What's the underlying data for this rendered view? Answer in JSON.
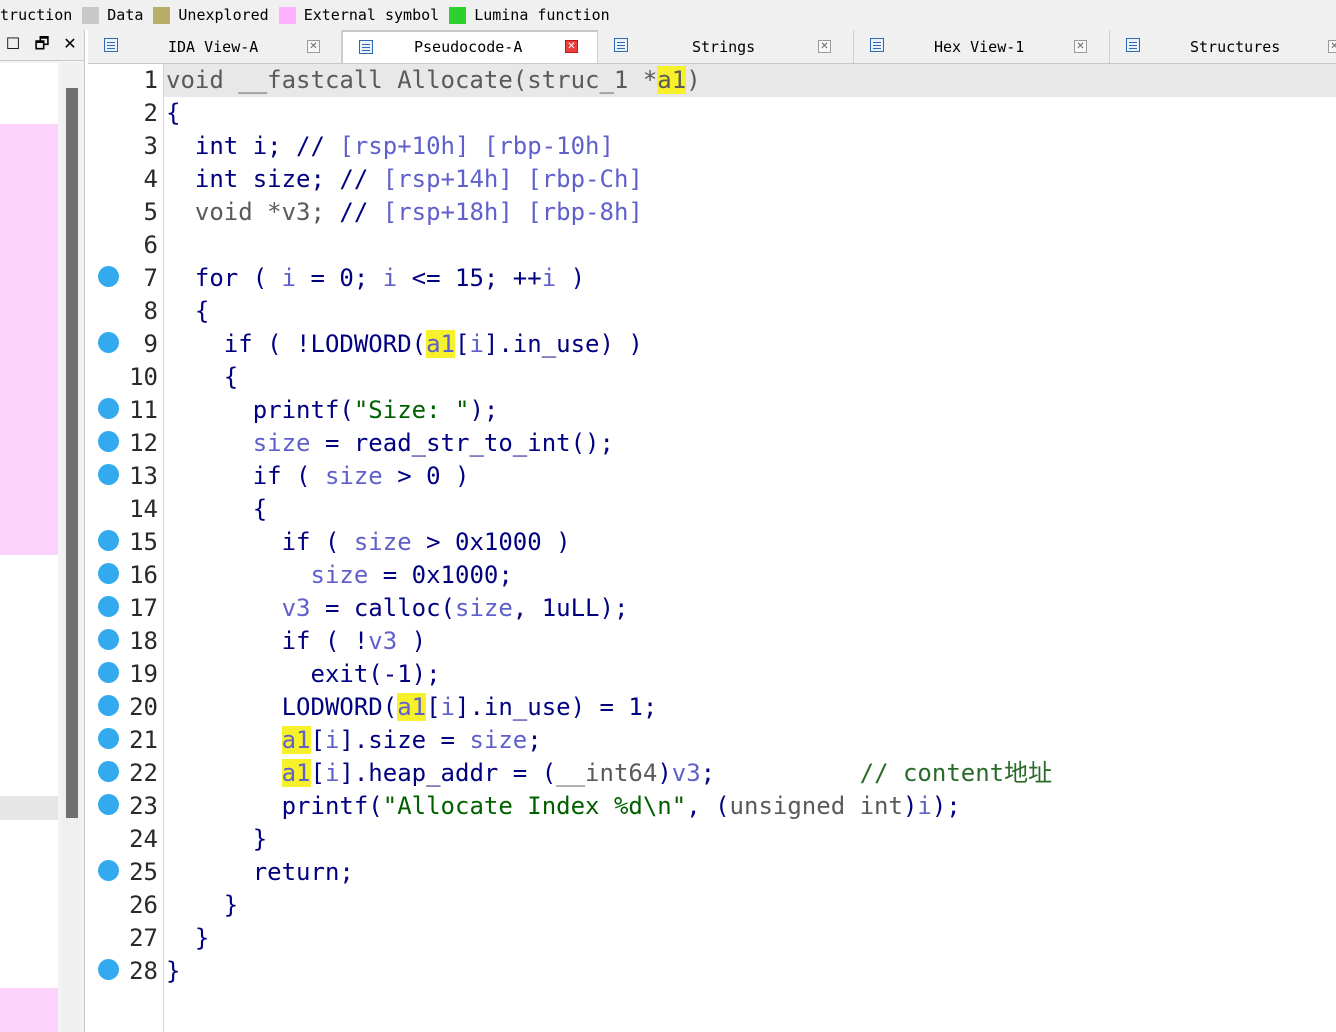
{
  "legend": {
    "first_label": "struction",
    "items": [
      {
        "label": "Data",
        "color": "#c8c8c8"
      },
      {
        "label": "Unexplored",
        "color": "#b8ae6a"
      },
      {
        "label": "External symbol",
        "color": "#ffb0ff"
      },
      {
        "label": "Lumina function",
        "color": "#2ed02e"
      }
    ]
  },
  "left_panel": {
    "buttons": [
      "☐",
      "🗗",
      "✕"
    ]
  },
  "tabs": [
    {
      "label": "IDA View-A",
      "icon": "ida-view-icon",
      "active": false
    },
    {
      "label": "Pseudocode-A",
      "icon": "pseudocode-icon",
      "active": true
    },
    {
      "label": "Strings",
      "icon": "strings-icon",
      "active": false
    },
    {
      "label": "Hex View-1",
      "icon": "hex-view-icon",
      "active": false
    },
    {
      "label": "Structures",
      "icon": "structures-icon",
      "active": false
    }
  ],
  "code": {
    "highlight_token": "a1",
    "lines": [
      {
        "n": "1",
        "bp": false,
        "html": "<span class=\"ty\">void __fastcall Allocate(struc_1 *</span><span class=\"ty hl\">a1</span><span class=\"ty\">)</span>"
      },
      {
        "n": "2",
        "bp": false,
        "html": "{"
      },
      {
        "n": "3",
        "bp": false,
        "html": "  int i; // <span class=\"cmv\">[rsp+10h] [rbp-10h]</span>"
      },
      {
        "n": "4",
        "bp": false,
        "html": "  int size; // <span class=\"cmv\">[rsp+14h] [rbp-Ch]</span>"
      },
      {
        "n": "5",
        "bp": false,
        "html": "  <span class=\"ty\">void *v3;</span> // <span class=\"cmv\">[rsp+18h] [rbp-8h]</span>"
      },
      {
        "n": "6",
        "bp": false,
        "html": ""
      },
      {
        "n": "7",
        "bp": true,
        "html": "  for ( <span class=\"va\">i</span> = 0; <span class=\"va\">i</span> &lt;= 15; ++<span class=\"va\">i</span> )"
      },
      {
        "n": "8",
        "bp": false,
        "html": "  {"
      },
      {
        "n": "9",
        "bp": true,
        "html": "    if ( !LODWORD(<span class=\"va hl\">a1</span>[<span class=\"va\">i</span>].in_use) )"
      },
      {
        "n": "10",
        "bp": false,
        "html": "    {"
      },
      {
        "n": "11",
        "bp": true,
        "html": "      printf(<span class=\"st\">\"Size: \"</span>);"
      },
      {
        "n": "12",
        "bp": true,
        "html": "      <span class=\"va\">size</span> = read_str_to_int();"
      },
      {
        "n": "13",
        "bp": true,
        "html": "      if ( <span class=\"va\">size</span> &gt; 0 )"
      },
      {
        "n": "14",
        "bp": false,
        "html": "      {"
      },
      {
        "n": "15",
        "bp": true,
        "html": "        if ( <span class=\"va\">size</span> &gt; 0x1000 )"
      },
      {
        "n": "16",
        "bp": true,
        "html": "          <span class=\"va\">size</span> = 0x1000;"
      },
      {
        "n": "17",
        "bp": true,
        "html": "        <span class=\"va\">v3</span> = calloc(<span class=\"va\">size</span>, 1uLL);"
      },
      {
        "n": "18",
        "bp": true,
        "html": "        if ( !<span class=\"va\">v3</span> )"
      },
      {
        "n": "19",
        "bp": true,
        "html": "          exit(-1);"
      },
      {
        "n": "20",
        "bp": true,
        "html": "        LODWORD(<span class=\"va hl\">a1</span>[<span class=\"va\">i</span>].in_use) = 1;"
      },
      {
        "n": "21",
        "bp": true,
        "html": "        <span class=\"va hl\">a1</span>[<span class=\"va\">i</span>].size = <span class=\"va\">size</span>;"
      },
      {
        "n": "22",
        "bp": true,
        "html": "        <span class=\"va hl\">a1</span>[<span class=\"va\">i</span>].heap_addr = (<span class=\"ty\">__int64</span>)<span class=\"va\">v3</span>;          <span class=\"cm\">// content地址</span>"
      },
      {
        "n": "23",
        "bp": true,
        "html": "        printf(<span class=\"st\">\"Allocate Index %d\\n\"</span>, (<span class=\"ty\">unsigned int</span>)<span class=\"va\">i</span>);"
      },
      {
        "n": "24",
        "bp": false,
        "html": "      }"
      },
      {
        "n": "25",
        "bp": true,
        "html": "      return;"
      },
      {
        "n": "26",
        "bp": false,
        "html": "    }"
      },
      {
        "n": "27",
        "bp": false,
        "html": "  }"
      },
      {
        "n": "28",
        "bp": true,
        "html": "}"
      }
    ]
  }
}
